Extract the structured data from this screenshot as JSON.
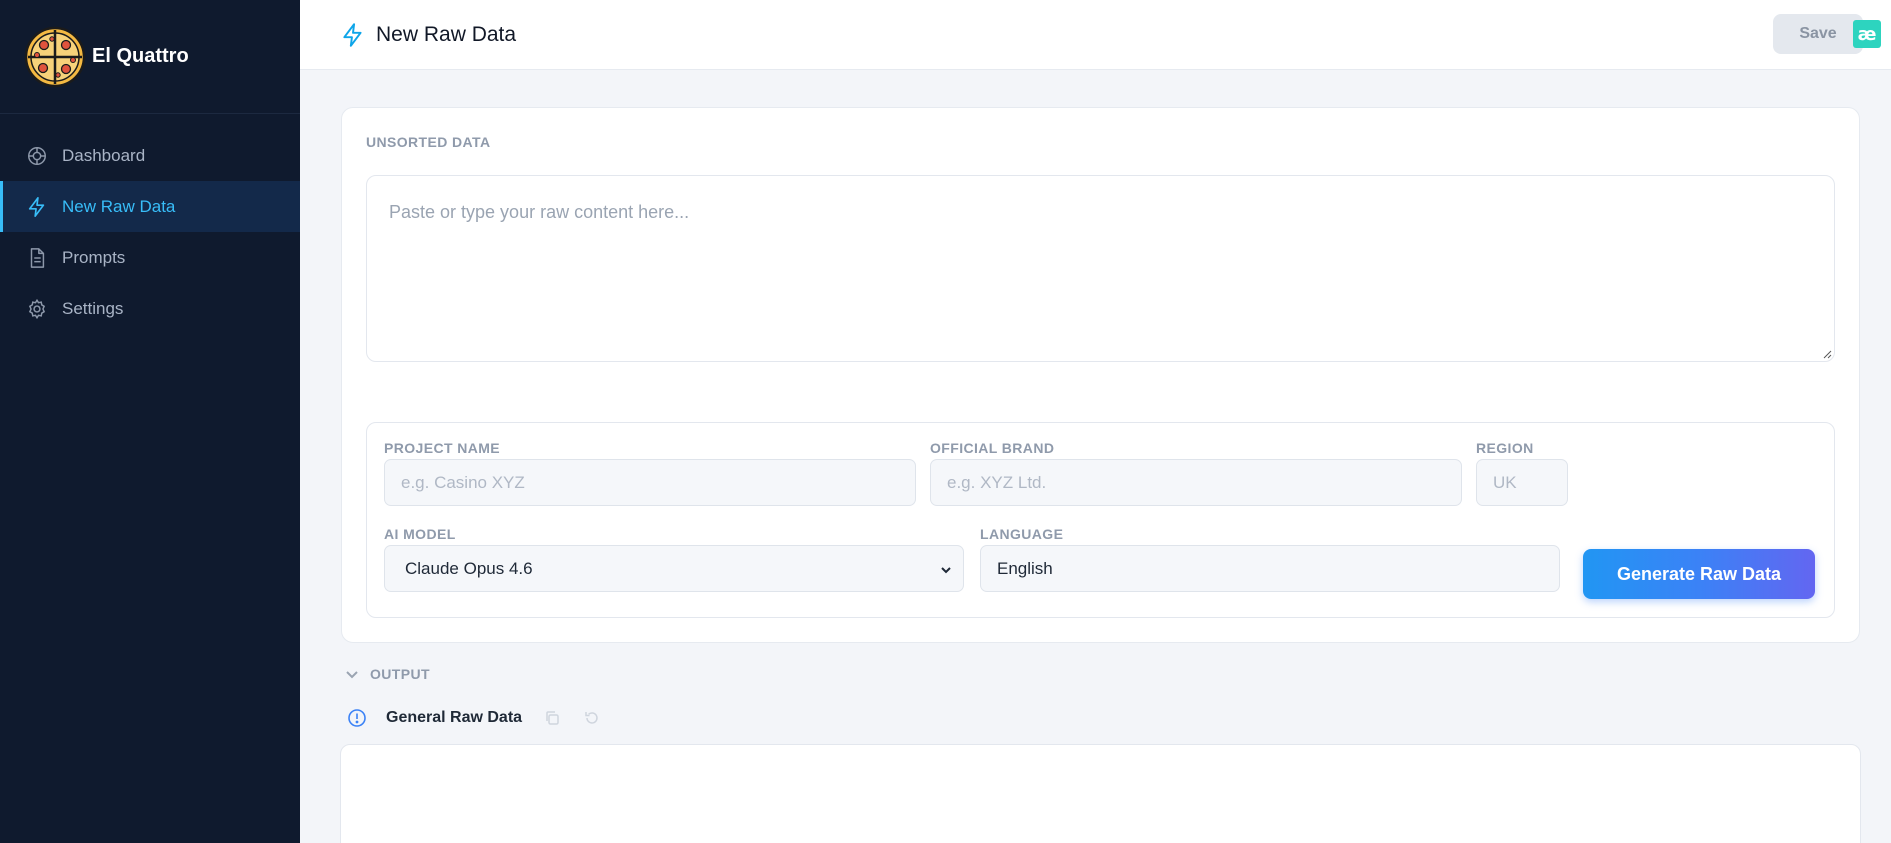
{
  "sidebar": {
    "brand_name": "El Quattro",
    "items": [
      {
        "label": "Dashboard",
        "icon": "dashboard-icon",
        "active": false
      },
      {
        "label": "New Raw Data",
        "icon": "lightning-icon",
        "active": true
      },
      {
        "label": "Prompts",
        "icon": "document-icon",
        "active": false
      },
      {
        "label": "Settings",
        "icon": "gear-icon",
        "active": false
      }
    ]
  },
  "header": {
    "title": "New Raw Data",
    "icon": "lightning-icon",
    "save_label": "Save",
    "extension_badge": "æ"
  },
  "unsorted": {
    "section_label": "UNSORTED DATA",
    "placeholder": "Paste or type your raw content here..."
  },
  "form": {
    "project_name": {
      "label": "PROJECT NAME",
      "placeholder": "e.g. Casino XYZ"
    },
    "official_brand": {
      "label": "OFFICIAL BRAND",
      "placeholder": "e.g. XYZ Ltd."
    },
    "region": {
      "label": "REGION",
      "placeholder": "UK"
    },
    "ai_model": {
      "label": "AI MODEL",
      "value": "Claude Opus 4.6"
    },
    "language": {
      "label": "LANGUAGE",
      "value": "English"
    },
    "generate_label": "Generate Raw Data"
  },
  "output": {
    "section_label": "OUTPUT",
    "title": "General Raw Data"
  },
  "colors": {
    "sidebar_bg": "#0f1a2e",
    "accent": "#38bdf8",
    "button_gradient_start": "#2196f3",
    "button_gradient_end": "#6366f1"
  }
}
